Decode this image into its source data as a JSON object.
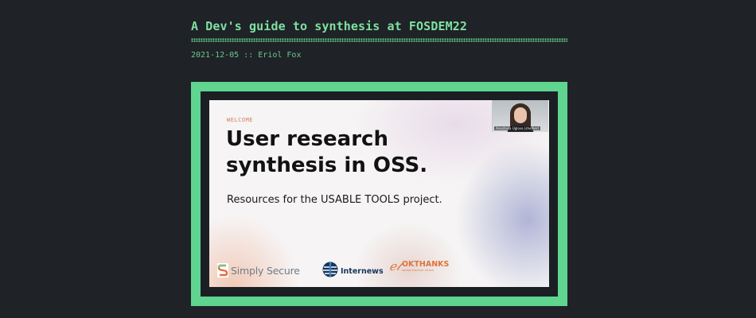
{
  "post": {
    "title": "A Dev's guide to synthesis at FOSDEM22",
    "meta": "2021-12-05 :: Eriol Fox"
  },
  "slide": {
    "kicker": "WELCOME",
    "heading": "User research synthesis in OSS.",
    "subtitle": "Resources for the USABLE TOOLS project.",
    "video_name": "Anastasia Uglova (she/her)",
    "logos": {
      "simply_secure": "Simply Secure",
      "internews": "Internews",
      "okthanks": "OKTHANKS",
      "okthanks_tagline": "DESIGN STRATEGY STUDIO"
    }
  },
  "colors": {
    "background": "#1f2226",
    "accent": "#7ee0a2",
    "frame": "#5fd590",
    "kicker": "#d2805c",
    "okthanks": "#e0743a",
    "internews": "#16355e"
  },
  "icons": {
    "simply_secure": "simply-secure-s-logo",
    "internews": "internews-globe-logo",
    "okthanks": "okthanks-script-logo"
  }
}
